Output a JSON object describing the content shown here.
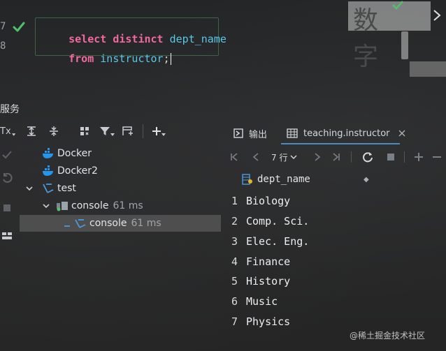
{
  "editor": {
    "line_numbers": [
      "7",
      "8"
    ],
    "line1": {
      "kw": "select distinct",
      "col": "dept_name"
    },
    "line2": {
      "kw": "from",
      "table": "instructor",
      "end": ";"
    },
    "status_icon": "check-icon",
    "background_watermark": "数 字"
  },
  "services": {
    "title": "服务",
    "toolbar": {
      "tx_label": "Tx",
      "icons": [
        "expand-all-icon",
        "collapse-all-icon",
        "group-icon",
        "filter-icon",
        "add-service-icon",
        "add-icon"
      ]
    },
    "tree": [
      {
        "label": "Docker",
        "meta": "",
        "icon": "docker-icon"
      },
      {
        "label": "Docker2",
        "meta": "",
        "icon": "docker-icon"
      },
      {
        "label": "test",
        "meta": "",
        "icon": "database-icon"
      },
      {
        "label": "console",
        "meta": "61 ms",
        "icon": "session-icon"
      },
      {
        "label": "console",
        "meta": "61 ms",
        "icon": "console-icon"
      }
    ]
  },
  "results": {
    "tabs": [
      {
        "label": "输出",
        "icon": "output-icon"
      },
      {
        "label": "teaching.instructor",
        "icon": "table-icon"
      }
    ],
    "nav": {
      "rows_label": "7 行"
    },
    "column": "dept_name",
    "rows": [
      {
        "n": "1",
        "v": "Biology"
      },
      {
        "n": "2",
        "v": "Comp. Sci."
      },
      {
        "n": "3",
        "v": "Elec. Eng."
      },
      {
        "n": "4",
        "v": "Finance"
      },
      {
        "n": "5",
        "v": "History"
      },
      {
        "n": "6",
        "v": "Music"
      },
      {
        "n": "7",
        "v": "Physics"
      }
    ]
  },
  "watermark": "@稀土掘金技术社区"
}
